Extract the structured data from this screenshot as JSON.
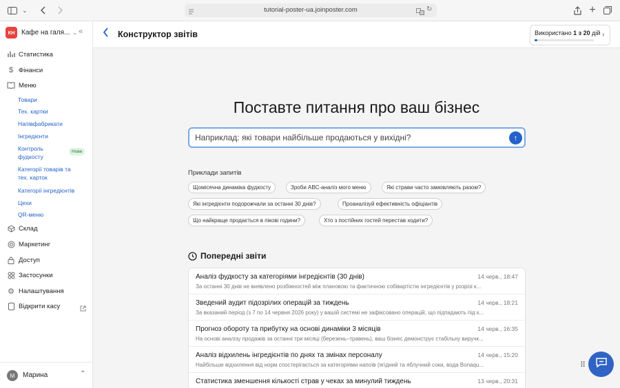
{
  "browser": {
    "url": "tutorial-poster-ua.joinposter.com"
  },
  "sidebar": {
    "brand_initials": "КН",
    "brand_name": "Кафе на галя...",
    "items": [
      {
        "label": "Статистика",
        "icon": "bar-chart-icon"
      },
      {
        "label": "Фінанси",
        "icon": "dollar-icon"
      },
      {
        "label": "Меню",
        "icon": "book-icon"
      }
    ],
    "menu_sub": [
      "Товари",
      "Тех. картки",
      "Напівфабрикати",
      "Інгредієнти",
      "Контроль фудкосту",
      "Категорії товарів та тех. карток",
      "Категорії інгредієнтів",
      "Цехи",
      "QR-меню"
    ],
    "new_badge": "Нове",
    "items2": [
      {
        "label": "Склад",
        "icon": "box-icon"
      },
      {
        "label": "Маркетинг",
        "icon": "target-icon"
      },
      {
        "label": "Доступ",
        "icon": "lock-icon"
      },
      {
        "label": "Застосунки",
        "icon": "apps-icon"
      },
      {
        "label": "Налаштування",
        "icon": "gear-icon"
      },
      {
        "label": "Відкрити касу",
        "icon": "tablet-icon"
      }
    ],
    "user_initial": "М",
    "user_name": "Марина"
  },
  "header": {
    "title": "Конструктор звітів",
    "usage_prefix": "Використано",
    "usage_count": "1 з 20",
    "usage_suffix": "дій",
    "usage_fraction": 0.05
  },
  "main": {
    "hero": "Поставте питання про ваш бізнес",
    "ask_placeholder": "Наприклад: які товари найбільше продаються у вихідні?",
    "examples_label": "Приклади запитів",
    "examples": [
      "Щомісячна динаміка фудкосту",
      "Зроби ABC-аналіз мого меню",
      "Які страви часто замовляють разом?",
      "Які інгредієнти подорожчали за останні 30 днів?",
      "Проаналізуй ефективність офіціантів",
      "Що найкраще продається в пікові години?",
      "Хто з постійних гостей перестав ходити?"
    ],
    "previous_title": "Попередні звіти",
    "reports": [
      {
        "title": "Аналіз фудкосту за категоріями інгредієнтів (30 днів)",
        "date": "14 черв., 18:47",
        "desc": "За останні 30 днів не виявлено розбіжностей між плановою та фактичною собівартістю інгредієнтів у розрізі к..."
      },
      {
        "title": "Зведений аудит підозрілих операцій за тиждень",
        "date": "14 черв., 18:21",
        "desc": "За вказаний період (з 7 по 14 червня 2026 року) у вашій системі не зафіксовано операцій, що підпадають під к..."
      },
      {
        "title": "Прогноз обороту та прибутку на основі динаміки 3 місяців",
        "date": "14 черв., 16:35",
        "desc": "На основі аналізу продажів за останні три місяці (березень–травень), ваш бізнес демонструє стабільну виручк..."
      },
      {
        "title": "Аналіз відхилень інгредієнтів по днях та змінах персоналу",
        "date": "14 черв., 15:20",
        "desc": "Найбільше відхилення від норм спостерігається за категоріями напоїв (ягідний та яблучний соки, вода Bonaqu..."
      },
      {
        "title": "Статистика зменшення кількості страв у чеках за минулий тиждень",
        "date": "13 черв., 20:31",
        "desc": ""
      }
    ]
  }
}
